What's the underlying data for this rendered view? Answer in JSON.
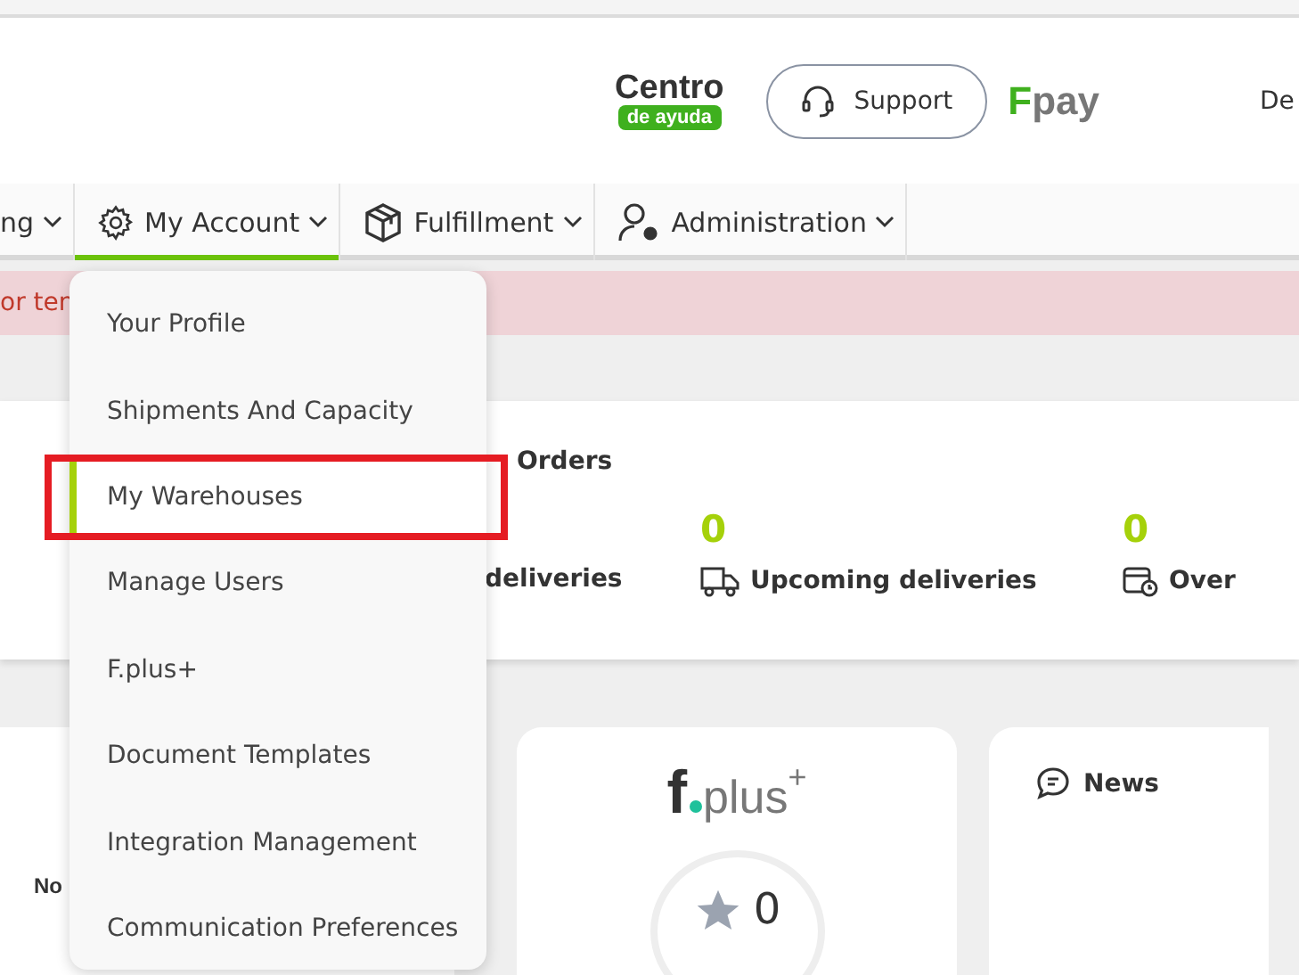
{
  "header": {
    "help_logo": {
      "line1": "Centro",
      "line2": "de ayuda"
    },
    "support_button": "Support",
    "pay_logo": "Fpay",
    "user_name": "De"
  },
  "nav": [
    {
      "label": "ng",
      "kind": "plain",
      "selected": false
    },
    {
      "label": "My Account",
      "kind": "gear",
      "selected": true
    },
    {
      "label": "Fulfillment",
      "kind": "box",
      "selected": false
    },
    {
      "label": "Administration",
      "kind": "user",
      "selected": false
    }
  ],
  "alert": "or ten",
  "orders_card": {
    "title": "Orders",
    "stats": [
      {
        "label": "deliveries",
        "kind": "plain"
      },
      {
        "value": "0",
        "label": "Upcoming deliveries",
        "kind": "truck"
      },
      {
        "value": "0",
        "label": "Over",
        "kind": "calendar"
      }
    ]
  },
  "left_card": {
    "text": "No"
  },
  "fplus_card": {
    "logo": {
      "letter": "f",
      "word": "plus",
      "mark": "+"
    },
    "score": "0"
  },
  "news_card": {
    "title": "News"
  },
  "dropdown": {
    "items": [
      {
        "label": "Your Profile",
        "selected": false,
        "highlighted": false
      },
      {
        "label": "Shipments And Capacity",
        "selected": false,
        "highlighted": false
      },
      {
        "label": "My Warehouses",
        "selected": true,
        "highlighted": true
      },
      {
        "label": "Manage Users",
        "selected": false,
        "highlighted": false
      },
      {
        "label": "F.plus+",
        "selected": false,
        "highlighted": false
      },
      {
        "label": "Document Templates",
        "selected": false,
        "highlighted": false
      },
      {
        "label": "Integration Management",
        "selected": false,
        "highlighted": false
      },
      {
        "label": "Communication Preferences",
        "selected": false,
        "highlighted": false
      }
    ]
  }
}
